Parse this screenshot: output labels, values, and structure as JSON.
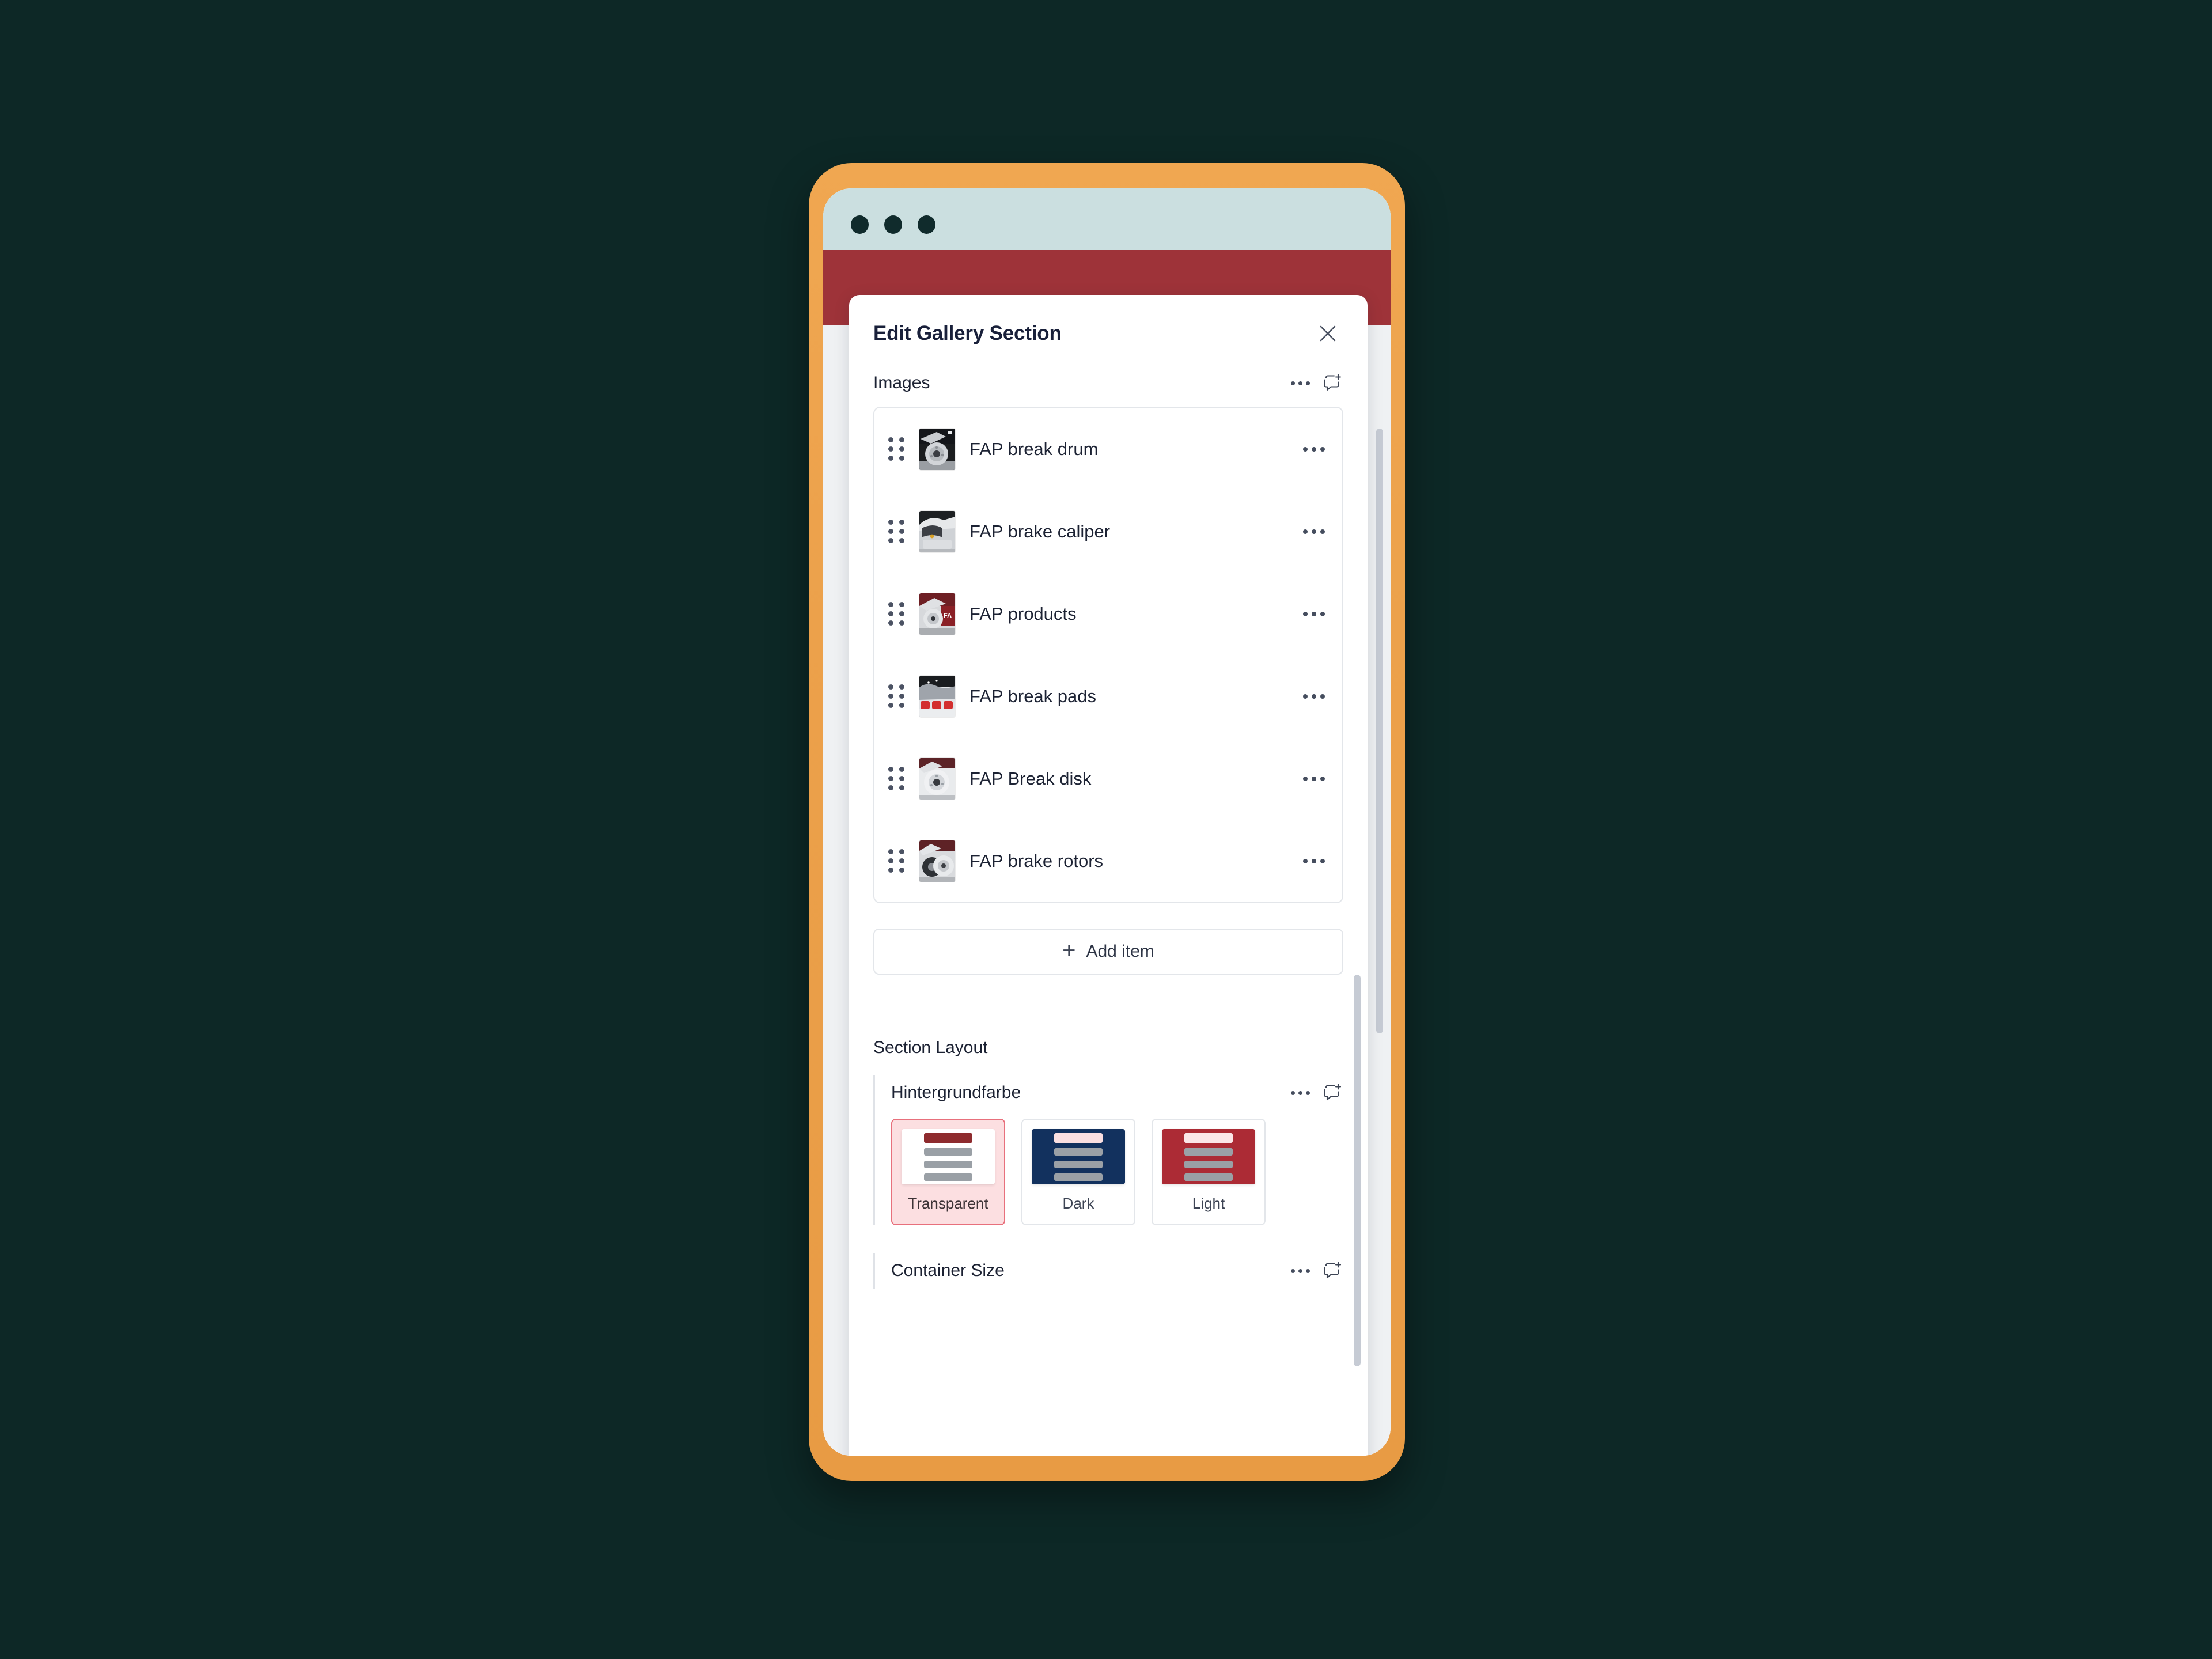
{
  "background": {
    "canvas_color": "#0d2826",
    "device_frame_color": "#eda34d"
  },
  "browser": {
    "chrome_color": "#cbdfe0",
    "traffic_lights": [
      "window-dot-1",
      "window-dot-2",
      "window-dot-3"
    ]
  },
  "page": {
    "hero_color": "#9e3339",
    "body_color": "#eff1f3"
  },
  "modal": {
    "title": "Edit Gallery Section",
    "close_label": "×",
    "images_field": {
      "label": "Images",
      "more_label": "…",
      "comment_label": "Add comment",
      "items": [
        {
          "name": "FAP break drum",
          "thumb": "brake-drum-photo"
        },
        {
          "name": "FAP brake caliper",
          "thumb": "brake-caliper-photo"
        },
        {
          "name": "FAP products",
          "thumb": "brake-products-photo"
        },
        {
          "name": "FAP break pads",
          "thumb": "brake-pads-photo"
        },
        {
          "name": "FAP Break disk",
          "thumb": "brake-disk-photo"
        },
        {
          "name": "FAP brake rotors",
          "thumb": "brake-rotors-photo"
        }
      ],
      "add_item_label": "Add item"
    },
    "section_layout": {
      "label": "Section Layout",
      "background_color_field": {
        "label": "Hintergrundfarbe",
        "selected": "Transparent",
        "options": [
          {
            "label": "Transparent",
            "preview_bg": "#ffffff",
            "accent": "#8e2b2e",
            "selected": true
          },
          {
            "label": "Dark",
            "preview_bg": "#12315e",
            "accent": "#fadfe1",
            "selected": false
          },
          {
            "label": "Light",
            "preview_bg": "#ac2b35",
            "accent": "#fbe6e8",
            "selected": false
          }
        ]
      },
      "container_size_field": {
        "label": "Container Size"
      }
    }
  }
}
